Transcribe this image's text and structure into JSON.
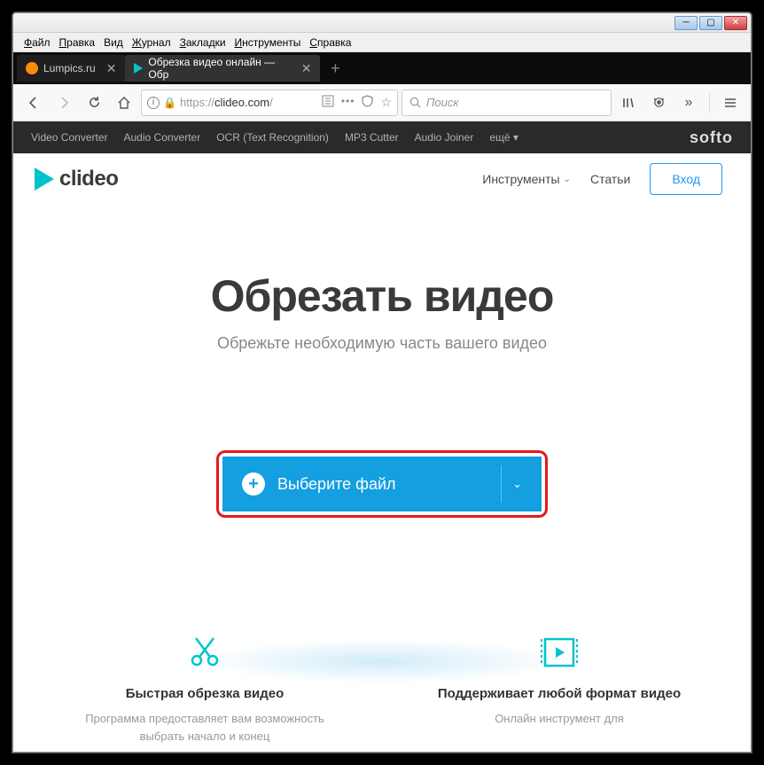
{
  "menubar": [
    "Файл",
    "Правка",
    "Вид",
    "Журнал",
    "Закладки",
    "Инструменты",
    "Справка"
  ],
  "tabs": [
    {
      "title": "Lumpics.ru",
      "active": false,
      "favicon": "orange"
    },
    {
      "title": "Обрезка видео онлайн — Обр",
      "active": true,
      "favicon": "play"
    }
  ],
  "url": {
    "prefix": "https://",
    "domain": "clideo.com",
    "path": "/"
  },
  "search_placeholder": "Поиск",
  "dark_toolbar": [
    "Video Converter",
    "Audio Converter",
    "OCR (Text Recognition)",
    "MP3 Cutter",
    "Audio Joiner",
    "ещё ▾"
  ],
  "dark_brand": "softo",
  "logo_text": "clideo",
  "nav": {
    "tools": "Инструменты",
    "articles": "Статьи",
    "login": "Вход"
  },
  "hero": {
    "title": "Обрезать видео",
    "subtitle": "Обрежьте необходимую часть вашего видео"
  },
  "upload_label": "Выберите файл",
  "features": [
    {
      "title": "Быстрая обрезка видео",
      "desc": "Программа предоставляет вам возможность выбрать начало и конец"
    },
    {
      "title": "Поддерживает любой формат видео",
      "desc": "Онлайн инструмент для"
    }
  ]
}
